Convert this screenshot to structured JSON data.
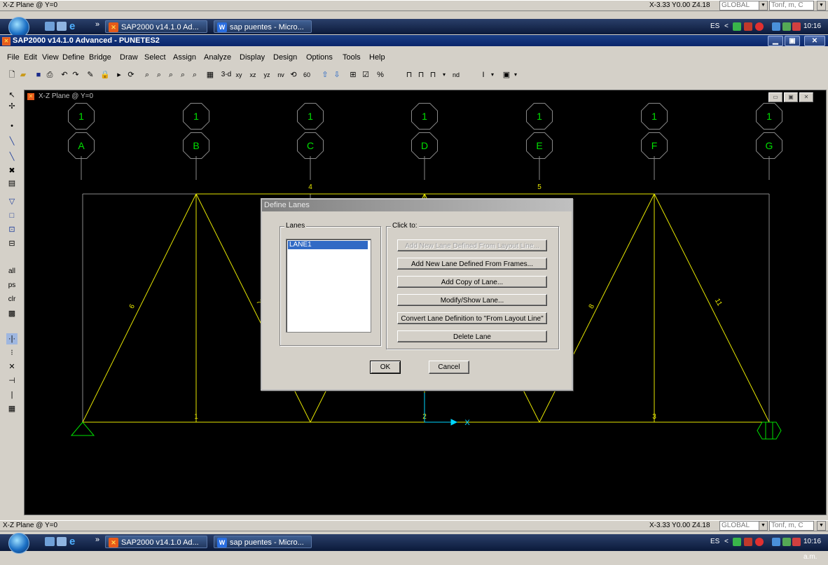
{
  "top_status": {
    "left": "X-Z Plane @ Y=0",
    "coords": "X-3.33  Y0.00  Z4.18",
    "coord_system": "GLOBAL",
    "units": "Tonf, m, C"
  },
  "bottom_status": {
    "left": "X-Z Plane @ Y=0",
    "coords": "X-3.33  Y0.00  Z4.18",
    "coord_system": "GLOBAL",
    "units": "Tonf, m, C"
  },
  "taskbar": {
    "chevron": "»",
    "buttons": [
      {
        "label": "SAP2000 v14.1.0 Ad...",
        "icon": "sap-icon"
      },
      {
        "label": "sap puentes - Micro...",
        "icon": "word-icon"
      }
    ],
    "lang": "ES",
    "time": "10:16 a.m."
  },
  "window": {
    "title": "SAP2000 v14.1.0 Advanced  - PUNETES2"
  },
  "menu": [
    "File",
    "Edit",
    "View",
    "Define",
    "Bridge",
    "Draw",
    "Select",
    "Assign",
    "Analyze",
    "Display",
    "Design",
    "Options",
    "Tools",
    "Help"
  ],
  "toolbar": {
    "view_3d": "3-d",
    "view_xy": "xy",
    "view_xz": "xz",
    "view_yz": "yz",
    "view_nv": "nv",
    "view_60": "60",
    "nd": "nd",
    "percent": "%"
  },
  "left_toolbar": {
    "all": "all",
    "ps": "ps",
    "clr": "clr"
  },
  "inner_window": {
    "title": "X-Z Plane @ Y=0"
  },
  "grid_bubbles": {
    "top": [
      "1",
      "1",
      "1",
      "1",
      "1",
      "1",
      "1"
    ],
    "bottom": [
      "A",
      "B",
      "C",
      "D",
      "E",
      "F",
      "G"
    ]
  },
  "frame_labels": {
    "top_chords": [
      "4",
      "5"
    ],
    "bottom_chords": [
      "1",
      "2",
      "3"
    ],
    "diagonals": [
      "6",
      "7",
      "8",
      "11"
    ]
  },
  "dialog": {
    "title": "Define Lanes",
    "lanes_group": "Lanes",
    "lanes": [
      "LANE1"
    ],
    "click_group": "Click to:",
    "buttons": {
      "add_layout": "Add New Lane Defined From Layout Line...",
      "add_frames": "Add New Lane Defined From Frames...",
      "add_copy": "Add Copy of Lane...",
      "modify": "Modify/Show Lane...",
      "convert": "Convert Lane Definition to \"From Layout Line\"",
      "delete": "Delete Lane"
    },
    "ok": "OK",
    "cancel": "Cancel"
  },
  "colors": {
    "canvas_bg": "#000000",
    "frame": "#e6e600",
    "grid": "#8a8a8a",
    "bubble": "#00e000",
    "axis": "#00d8ff",
    "title_bar": "#0a246a",
    "selection": "#316ac5"
  }
}
